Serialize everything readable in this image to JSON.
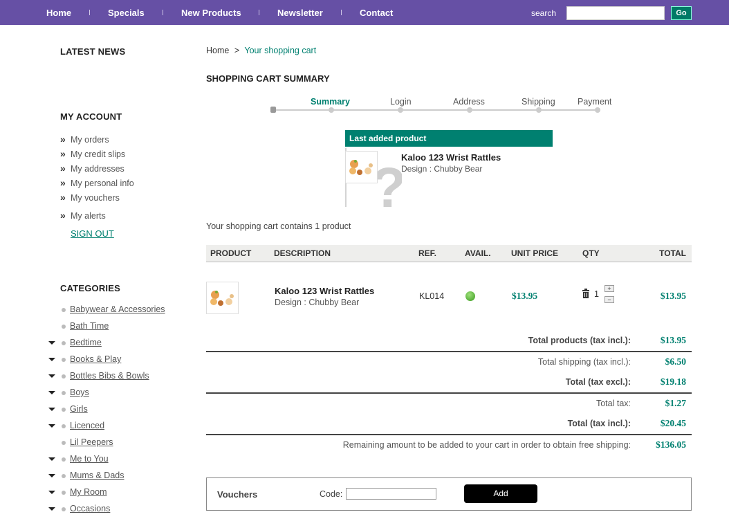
{
  "nav": {
    "items": [
      "Home",
      "Specials",
      "New Products",
      "Newsletter",
      "Contact"
    ],
    "search_label": "search",
    "search_value": "",
    "go_label": "Go"
  },
  "sidebar": {
    "news_title": "LATEST NEWS",
    "account_title": "MY ACCOUNT",
    "account_items": [
      "My orders",
      "My credit slips",
      "My addresses",
      "My personal info",
      "My vouchers",
      "My alerts"
    ],
    "sign_out": "SIGN OUT",
    "categories_title": "CATEGORIES",
    "categories": [
      {
        "label": "Babywear & Accessories",
        "expandable": false
      },
      {
        "label": "Bath Time",
        "expandable": false
      },
      {
        "label": "Bedtime",
        "expandable": true
      },
      {
        "label": "Books & Play",
        "expandable": true
      },
      {
        "label": "Bottles Bibs & Bowls",
        "expandable": true
      },
      {
        "label": "Boys",
        "expandable": true
      },
      {
        "label": "Girls",
        "expandable": true
      },
      {
        "label": "Licenced",
        "expandable": true
      },
      {
        "label": "Lil Peepers",
        "expandable": false
      },
      {
        "label": "Me to You",
        "expandable": true
      },
      {
        "label": "Mums & Dads",
        "expandable": true
      },
      {
        "label": "My Room",
        "expandable": true
      },
      {
        "label": "Occasions",
        "expandable": true
      }
    ]
  },
  "breadcrumb": {
    "home": "Home",
    "sep": ">",
    "current": "Your shopping cart"
  },
  "page_title": "SHOPPING CART SUMMARY",
  "steps": [
    "Summary",
    "Login",
    "Address",
    "Shipping",
    "Payment"
  ],
  "last_added": {
    "header": "Last added product",
    "name": "Kaloo 123 Wrist Rattles",
    "attributes": "Design : Chubby Bear"
  },
  "cart_count_text": "Your shopping cart contains 1 product",
  "table": {
    "headers": [
      "PRODUCT",
      "DESCRIPTION",
      "REF.",
      "AVAIL.",
      "UNIT PRICE",
      "QTY",
      "TOTAL"
    ],
    "row": {
      "name": "Kaloo 123 Wrist Rattles",
      "attributes": "Design : Chubby Bear",
      "ref": "KL014",
      "unit_price": "$13.95",
      "qty": "1",
      "total": "$13.95"
    }
  },
  "totals": [
    {
      "label": "Total products (tax incl.):",
      "value": "$13.95",
      "bold": true
    },
    {
      "label": "Total shipping (tax incl.):",
      "value": "$6.50",
      "bold": false
    },
    {
      "label": "Total (tax excl.):",
      "value": "$19.18",
      "bold": true
    },
    {
      "label": "Total tax:",
      "value": "$1.27",
      "bold": false
    },
    {
      "label": "Total (tax incl.):",
      "value": "$20.45",
      "bold": true
    },
    {
      "label": "Remaining amount to be added to your cart in order to obtain free shipping:",
      "value": "$136.05",
      "bold": false
    }
  ],
  "vouchers": {
    "title": "Vouchers",
    "code_label": "Code:",
    "code_value": "",
    "add_label": "Add"
  },
  "colors": {
    "nav_bg": "#6650a5",
    "accent": "#008070",
    "avail": "#4caf2a"
  }
}
